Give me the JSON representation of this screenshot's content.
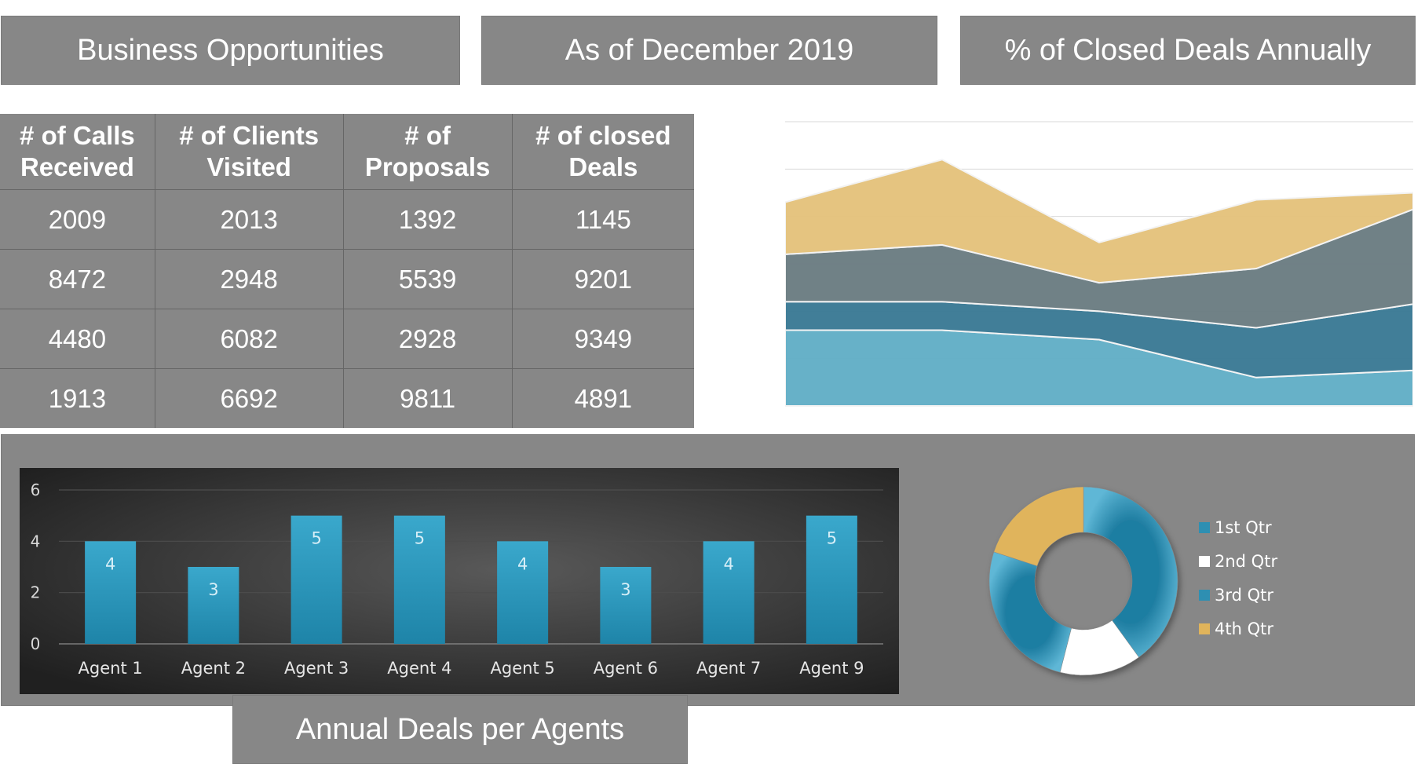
{
  "headers": {
    "business": "Business Opportunities",
    "as_of": "As of December 2019",
    "closed_pct": "% of Closed Deals Annually",
    "annual": "Annual Deals per Agents"
  },
  "table": {
    "columns": [
      [
        "# of Calls",
        "Received"
      ],
      [
        "# of Clients",
        "Visited"
      ],
      [
        "# of",
        "Proposals"
      ],
      [
        "# of closed",
        "Deals"
      ]
    ],
    "rows": [
      [
        "2009",
        "2013",
        "1392",
        "1145"
      ],
      [
        "8472",
        "2948",
        "5539",
        "9201"
      ],
      [
        "4480",
        "6082",
        "2928",
        "9349"
      ],
      [
        "1913",
        "6692",
        "9811",
        "4891"
      ]
    ]
  },
  "colors": {
    "panel_gray": "#878787",
    "teal_light": "#62aec6",
    "teal_dark": "#3b7a95",
    "slate": "#6b7d82",
    "gold": "#e4c27c",
    "bar_blue": "#2e97bd",
    "donut_gold": "#e0b45b"
  },
  "chart_data": [
    {
      "type": "area",
      "stacked": true,
      "x": [
        1,
        2,
        3,
        4,
        5
      ],
      "ylim": [
        0,
        6
      ],
      "grid": true,
      "series": [
        {
          "values": [
            1.6,
            1.6,
            1.4,
            0.6,
            0.75
          ],
          "color": "#62aec6"
        },
        {
          "values": [
            0.6,
            0.6,
            0.6,
            1.05,
            1.4
          ],
          "color": "#3b7a95"
        },
        {
          "values": [
            1.0,
            1.2,
            0.6,
            1.25,
            2.0
          ],
          "color": "#6b7d82"
        },
        {
          "values": [
            1.1,
            1.8,
            0.85,
            1.45,
            0.35
          ],
          "color": "#e4c27c"
        }
      ]
    },
    {
      "type": "bar",
      "categories": [
        "Agent 1",
        "Agent 2",
        "Agent 3",
        "Agent 4",
        "Agent 5",
        "Agent 6",
        "Agent 7",
        "Agent 9"
      ],
      "values": [
        4,
        3,
        5,
        5,
        4,
        3,
        4,
        5
      ],
      "ylim": [
        0,
        6
      ],
      "yticks": [
        0,
        2,
        4,
        6
      ],
      "grid": true,
      "data_labels": true
    },
    {
      "type": "pie",
      "donut": true,
      "labels": [
        "1st Qtr",
        "2nd Qtr",
        "3rd Qtr",
        "4th Qtr"
      ],
      "values": [
        40,
        14,
        26,
        20
      ],
      "colors": [
        "#2e8fb2",
        "#ffffff",
        "#2e8fb2",
        "#e0b45b"
      ],
      "legend": "right"
    }
  ]
}
